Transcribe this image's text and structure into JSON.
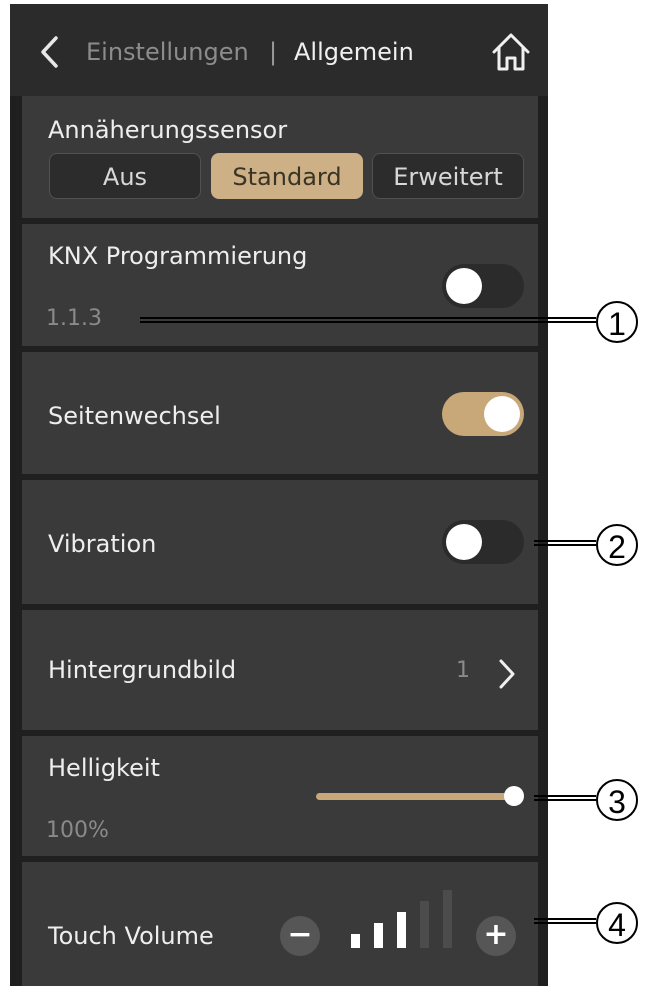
{
  "header": {
    "breadcrumb_parent": "Einstellungen",
    "breadcrumb_separator": "|",
    "title": "Allgemein"
  },
  "proximity": {
    "label": "Annäherungssensor",
    "options": [
      "Aus",
      "Standard",
      "Erweitert"
    ],
    "selected": "Standard"
  },
  "knx": {
    "label": "KNX Programmierung",
    "address": "1.1.3",
    "enabled": false
  },
  "page_change": {
    "label": "Seitenwechsel",
    "enabled": true
  },
  "vibration": {
    "label": "Vibration",
    "enabled": false
  },
  "wallpaper": {
    "label": "Hintergrundbild",
    "value": "1"
  },
  "brightness": {
    "label": "Helligkeit",
    "value": "100%",
    "level": 1.0
  },
  "touch_volume": {
    "label": "Touch Volume",
    "minus": "−",
    "plus": "+",
    "level": 3,
    "max_level": 5
  },
  "callouts": [
    "1",
    "2",
    "3",
    "4"
  ],
  "colors": {
    "accent": "#cdb086",
    "background": "#1f1f1f",
    "card": "#3a3a3a",
    "header": "#2b2b2b"
  }
}
